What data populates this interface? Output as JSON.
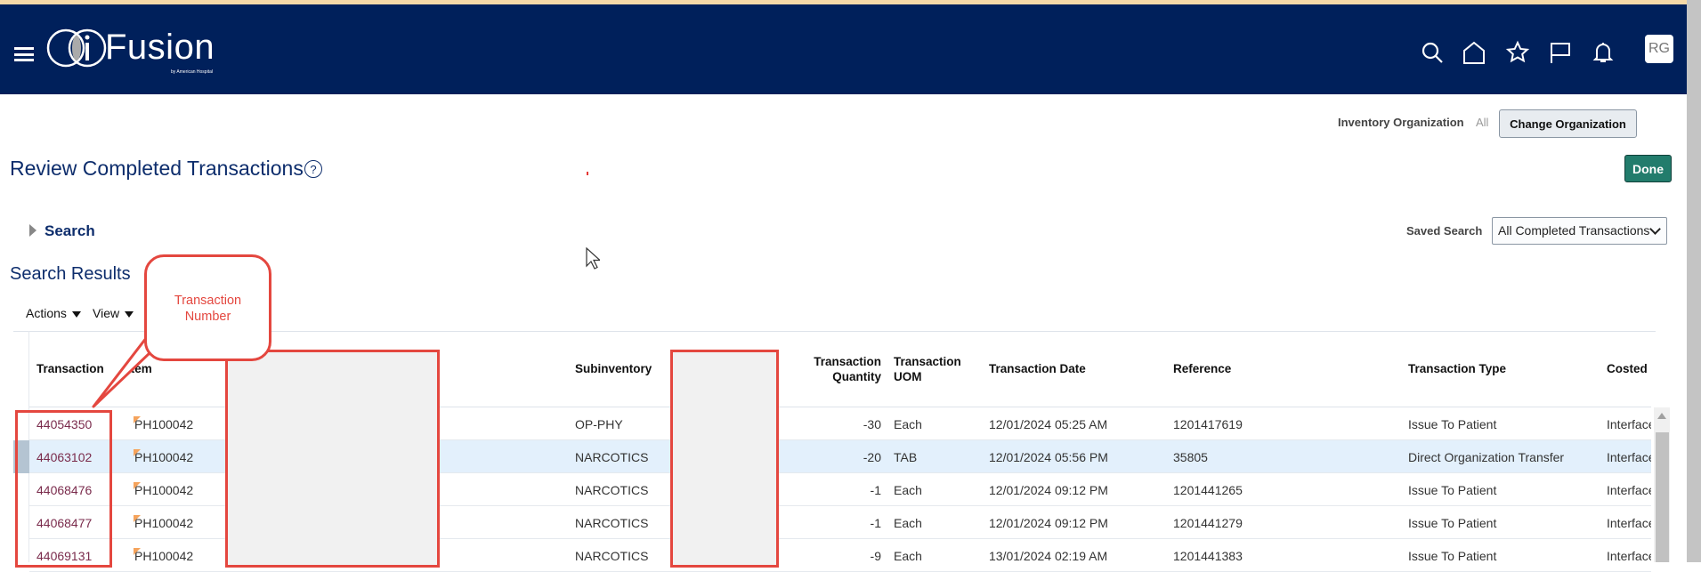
{
  "header": {
    "logo_text": "Fusion",
    "logo_subtitle": "by American Hospital",
    "avatar": "RG",
    "icons": [
      "search-icon",
      "home-icon",
      "star-icon",
      "flag-icon",
      "bell-icon"
    ]
  },
  "org": {
    "label": "Inventory Organization",
    "value": "All",
    "change_button": "Change Organization"
  },
  "page": {
    "title": "Review Completed Transactions",
    "help": "?",
    "done_button": "Done"
  },
  "search": {
    "label": "Search",
    "saved_search_label": "Saved Search",
    "saved_search_value": "All Completed Transactions"
  },
  "results": {
    "title": "Search Results",
    "actions": "Actions",
    "view": "View"
  },
  "table": {
    "headers": {
      "transaction": "Transaction",
      "item": "Item",
      "subinventory": "Subinventory",
      "qty_1": "Transaction",
      "qty_2": "Quantity",
      "uom_1": "Transaction",
      "uom_2": "UOM",
      "date": "Transaction Date",
      "reference": "Reference",
      "type": "Transaction Type",
      "costed": "Costed"
    },
    "rows": [
      {
        "transaction": "44054350",
        "item": "PH100042",
        "subinventory": "OP-PHY",
        "qty": "-30",
        "uom": "Each",
        "date": "12/01/2024 05:25 AM",
        "reference": "1201417619",
        "type": "Issue To Patient",
        "costed": "Interface"
      },
      {
        "transaction": "44063102",
        "item": "PH100042",
        "subinventory": "NARCOTICS",
        "qty": "-20",
        "uom": "TAB",
        "date": "12/01/2024 05:56 PM",
        "reference": "35805",
        "type": "Direct Organization Transfer",
        "costed": "Interface"
      },
      {
        "transaction": "44068476",
        "item": "PH100042",
        "subinventory": "NARCOTICS",
        "qty": "-1",
        "uom": "Each",
        "date": "12/01/2024 09:12 PM",
        "reference": "1201441265",
        "type": "Issue To Patient",
        "costed": "Interface"
      },
      {
        "transaction": "44068477",
        "item": "PH100042",
        "subinventory": "NARCOTICS",
        "qty": "-1",
        "uom": "Each",
        "date": "12/01/2024 09:12 PM",
        "reference": "1201441279",
        "type": "Issue To Patient",
        "costed": "Interface"
      },
      {
        "transaction": "44069131",
        "item": "PH100042",
        "subinventory": "NARCOTICS",
        "qty": "-9",
        "uom": "Each",
        "date": "13/01/2024 02:19 AM",
        "reference": "1201441383",
        "type": "Issue To Patient",
        "costed": "Interface"
      }
    ]
  },
  "annotation": {
    "callout_line1": "Transaction",
    "callout_line2": "Number"
  },
  "colors": {
    "header_bg": "#00205b",
    "link": "#7a2b4c",
    "done": "#227c6c",
    "annotation": "#e4473f"
  }
}
